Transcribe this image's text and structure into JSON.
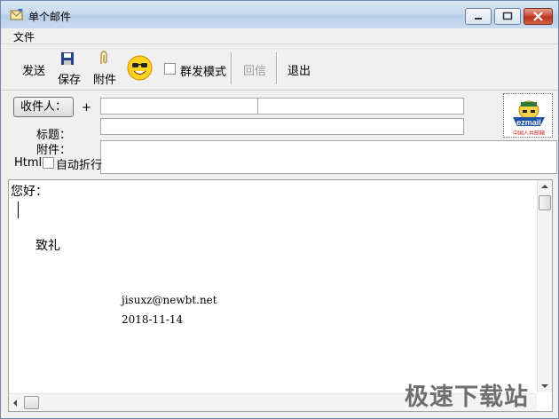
{
  "window": {
    "title": "单个邮件"
  },
  "menu": {
    "items": [
      "文件"
    ]
  },
  "toolbar": {
    "send": "发送",
    "save": "保存",
    "attach": "附件",
    "group_mode": "群发模式",
    "group_mode_checked": false,
    "reply": "回信",
    "exit": "退出"
  },
  "header": {
    "recipient_button": "收件人：",
    "add": "+",
    "subject_label": "标题：",
    "attachment_label": "附件：",
    "html_label": "Html",
    "auto_wrap_label": "自动折行",
    "recipient_value": "",
    "subject_value": ""
  },
  "logo": {
    "text": "ezmail",
    "subtext": "中国人共邮箱"
  },
  "body": {
    "greeting": "您好：",
    "regards": "致礼",
    "email": "jisuxz@newbt.net",
    "date": "2018-11-14"
  },
  "watermark": "极速下载站"
}
